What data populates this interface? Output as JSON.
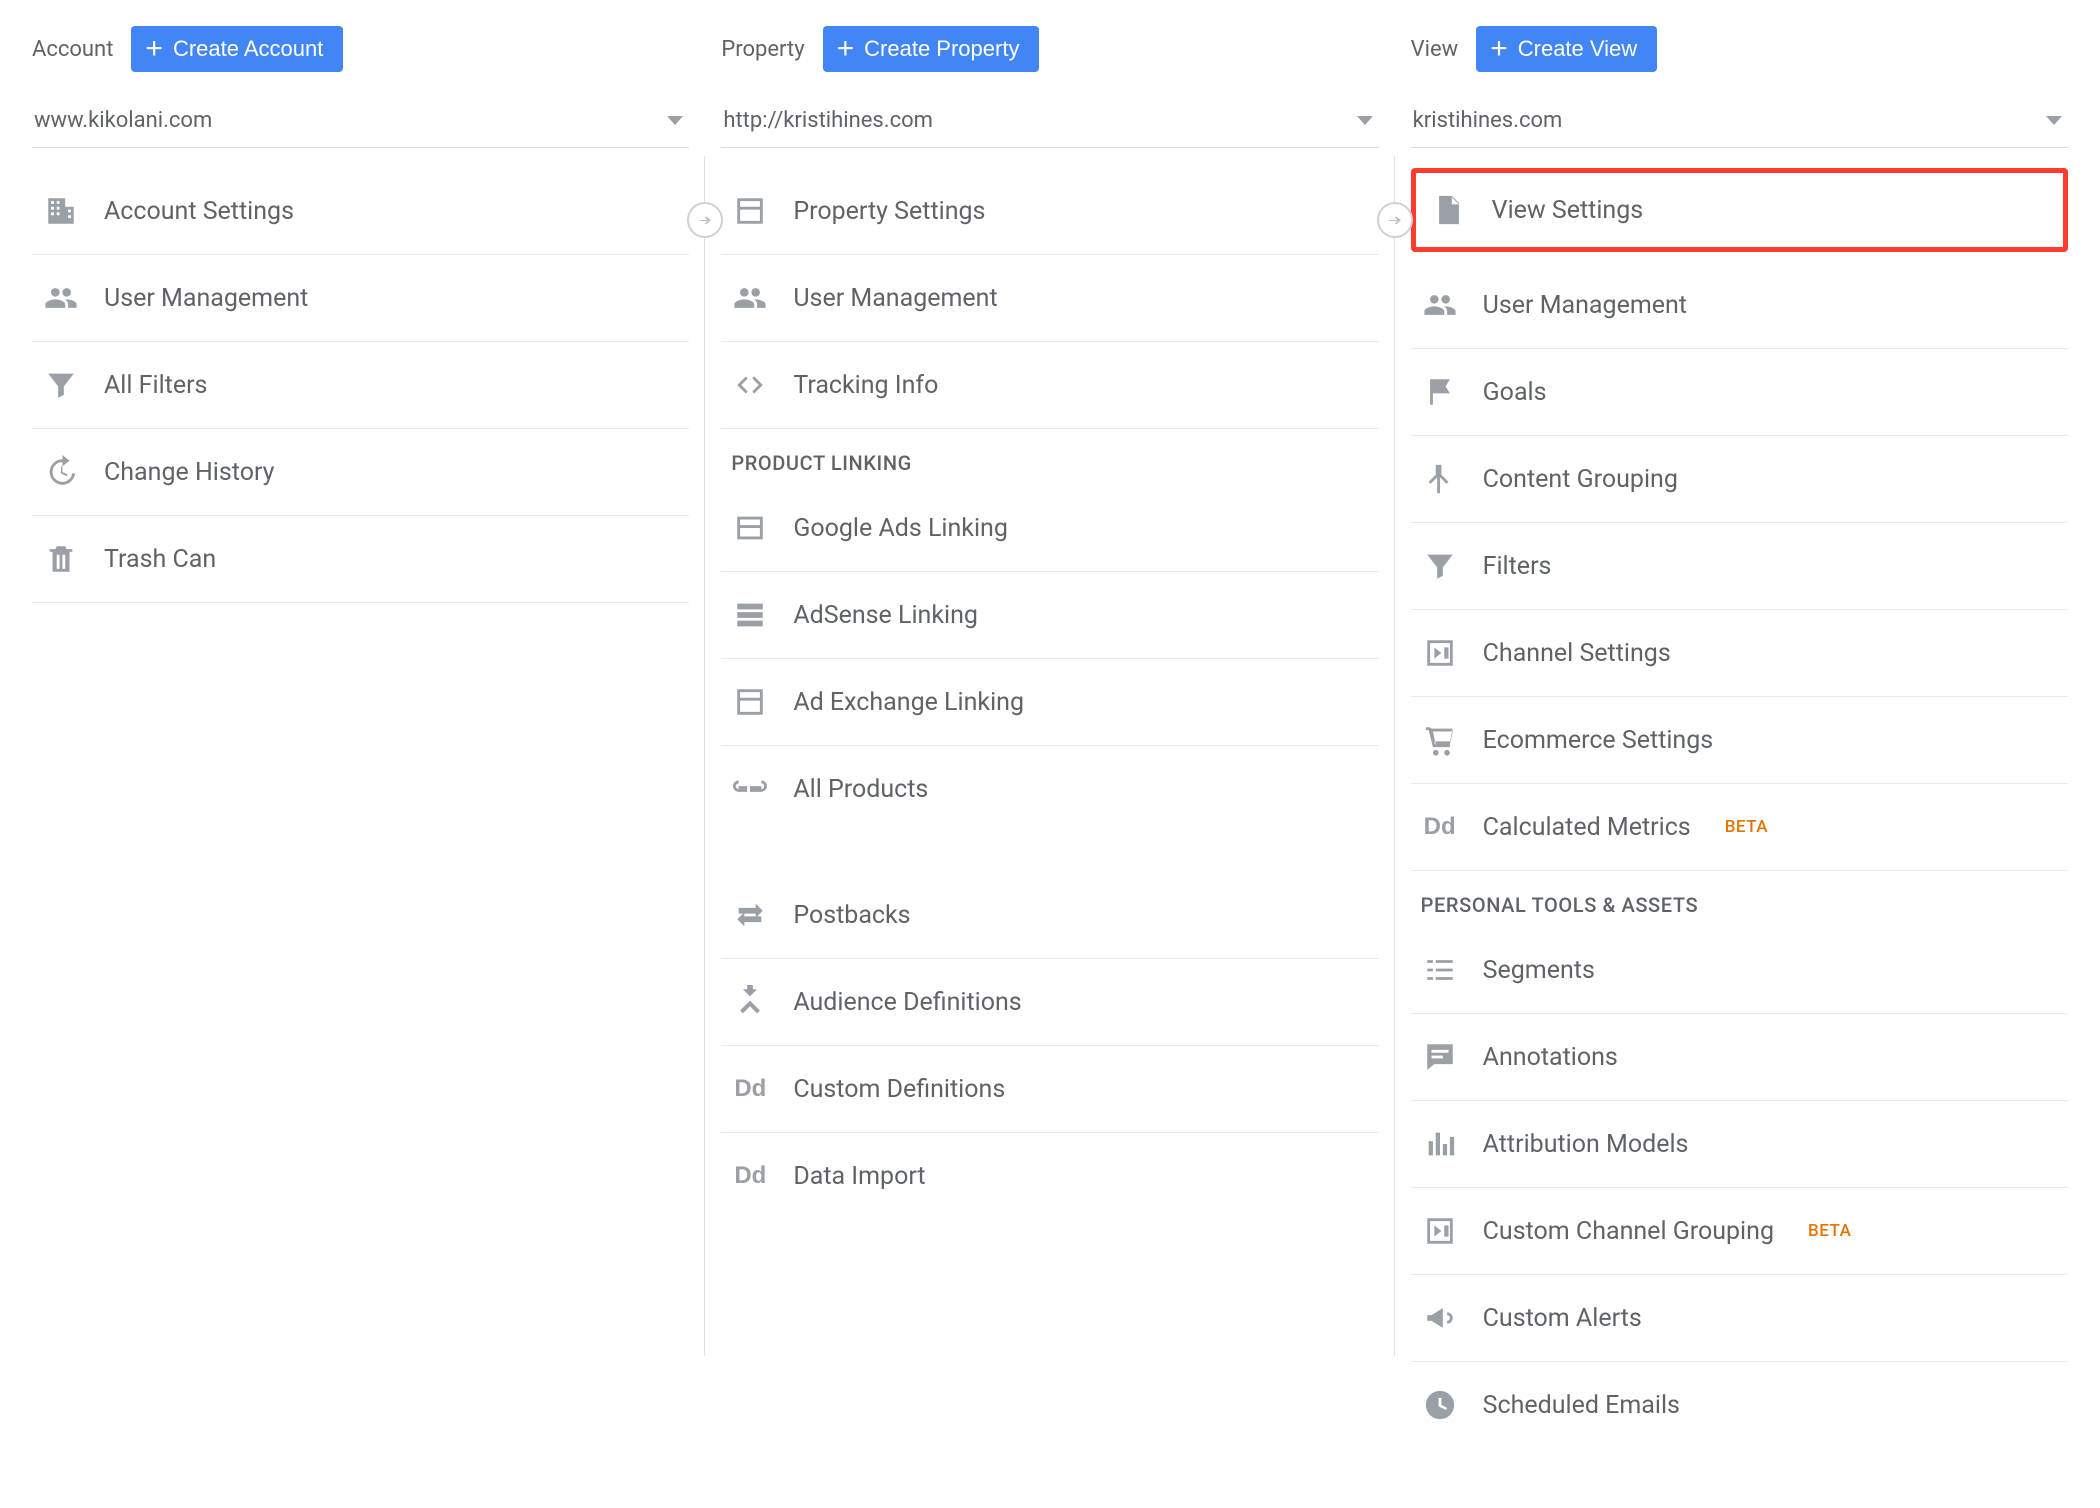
{
  "account": {
    "label": "Account",
    "create": "Create Account",
    "selected": "www.kikolani.com",
    "items": [
      {
        "label": "Account Settings",
        "icon": "building"
      },
      {
        "label": "User Management",
        "icon": "people"
      },
      {
        "label": "All Filters",
        "icon": "funnel"
      },
      {
        "label": "Change History",
        "icon": "history"
      },
      {
        "label": "Trash Can",
        "icon": "trash"
      }
    ]
  },
  "property": {
    "label": "Property",
    "create": "Create Property",
    "selected": "http://kristihines.com",
    "items": [
      {
        "label": "Property Settings",
        "icon": "layout"
      },
      {
        "label": "User Management",
        "icon": "people"
      },
      {
        "label": "Tracking Info",
        "icon": "code"
      }
    ],
    "section1": "PRODUCT LINKING",
    "linking": [
      {
        "label": "Google Ads Linking",
        "icon": "layout2"
      },
      {
        "label": "AdSense Linking",
        "icon": "list"
      },
      {
        "label": "Ad Exchange Linking",
        "icon": "layout"
      },
      {
        "label": "All Products",
        "icon": "link"
      }
    ],
    "extras": [
      {
        "label": "Postbacks",
        "icon": "swap"
      },
      {
        "label": "Audience Definitions",
        "icon": "split"
      },
      {
        "label": "Custom Definitions",
        "icon": "dd"
      },
      {
        "label": "Data Import",
        "icon": "dd"
      }
    ]
  },
  "view": {
    "label": "View",
    "create": "Create View",
    "selected": "kristihines.com",
    "highlighted": "View Settings",
    "items": [
      {
        "label": "User Management",
        "icon": "people"
      },
      {
        "label": "Goals",
        "icon": "flag"
      },
      {
        "label": "Content Grouping",
        "icon": "merge"
      },
      {
        "label": "Filters",
        "icon": "funnel"
      },
      {
        "label": "Channel Settings",
        "icon": "channels"
      },
      {
        "label": "Ecommerce Settings",
        "icon": "cart"
      },
      {
        "label": "Calculated Metrics",
        "icon": "dd",
        "badge": "BETA"
      }
    ],
    "section1": "PERSONAL TOOLS & ASSETS",
    "tools": [
      {
        "label": "Segments",
        "icon": "segments"
      },
      {
        "label": "Annotations",
        "icon": "comment"
      },
      {
        "label": "Attribution Models",
        "icon": "bars"
      },
      {
        "label": "Custom Channel Grouping",
        "icon": "channels",
        "badge": "BETA"
      },
      {
        "label": "Custom Alerts",
        "icon": "megaphone"
      },
      {
        "label": "Scheduled Emails",
        "icon": "clock"
      }
    ]
  }
}
